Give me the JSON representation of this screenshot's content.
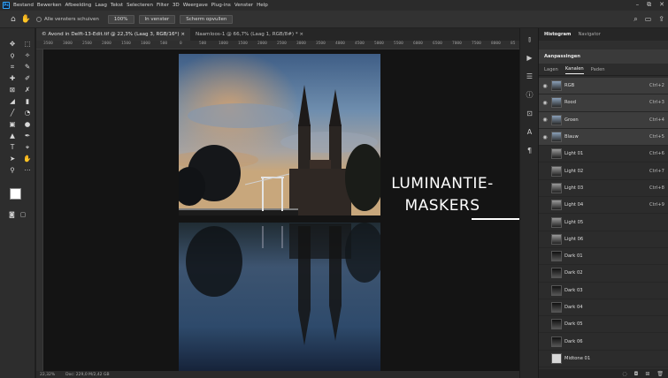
{
  "menu": [
    "Bestand",
    "Bewerken",
    "Afbeelding",
    "Laag",
    "Tekst",
    "Selecteren",
    "Filter",
    "3D",
    "Weergave",
    "Plug-ins",
    "Venster",
    "Help"
  ],
  "options": {
    "scroll_all_label": "Alle vensters schuiven",
    "zoom_value": "100%",
    "fit_label": "In venster",
    "fill_label": "Scherm opvullen"
  },
  "tabs": [
    {
      "label": "© Avond in Delft-13-Edit.tif @ 22,3% (Laag 3, RGB/16*) × "
    },
    {
      "label": "Naamloos-1 @ 66,7% (Laag 1, RGB/8#) * ×"
    }
  ],
  "ruler_ticks": [
    "3500",
    "3000",
    "2500",
    "2000",
    "1500",
    "1000",
    "500",
    "0",
    "500",
    "1000",
    "1500",
    "2000",
    "2500",
    "3000",
    "3500",
    "4000",
    "4500",
    "5000",
    "5500",
    "6000",
    "6500",
    "7000",
    "7500",
    "8000",
    "85"
  ],
  "status": {
    "zoom": "22,32%",
    "doc": "Doc: 229,0 M/2,42 GB"
  },
  "annotation": {
    "line1": "LUMINANTIE-",
    "line2": "MASKERS"
  },
  "panel_top_tabs": [
    "Histogram",
    "Navigator"
  ],
  "adjust_label": "Aanpassingen",
  "channel_tabs": [
    "Lagen",
    "Kanalen",
    "Paden"
  ],
  "channels": [
    {
      "name": "RGB",
      "shortcut": "Ctrl+2",
      "eye": true
    },
    {
      "name": "Rood",
      "shortcut": "Ctrl+3",
      "eye": true
    },
    {
      "name": "Groen",
      "shortcut": "Ctrl+4",
      "eye": true
    },
    {
      "name": "Blauw",
      "shortcut": "Ctrl+5",
      "eye": true
    },
    {
      "name": "Light 01",
      "shortcut": "Ctrl+6",
      "eye": false
    },
    {
      "name": "Light 02",
      "shortcut": "Ctrl+7",
      "eye": false
    },
    {
      "name": "Light 03",
      "shortcut": "Ctrl+8",
      "eye": false
    },
    {
      "name": "Light 04",
      "shortcut": "Ctrl+9",
      "eye": false
    },
    {
      "name": "Light 05",
      "shortcut": "",
      "eye": false
    },
    {
      "name": "Light 06",
      "shortcut": "",
      "eye": false
    },
    {
      "name": "Dark 01",
      "shortcut": "",
      "eye": false
    },
    {
      "name": "Dark 02",
      "shortcut": "",
      "eye": false
    },
    {
      "name": "Dark 03",
      "shortcut": "",
      "eye": false
    },
    {
      "name": "Dark 04",
      "shortcut": "",
      "eye": false
    },
    {
      "name": "Dark 05",
      "shortcut": "",
      "eye": false
    },
    {
      "name": "Dark 06",
      "shortcut": "",
      "eye": false
    },
    {
      "name": "Midtone 01",
      "shortcut": "",
      "eye": false
    }
  ],
  "colors": {
    "accent": "#31a8ff",
    "foreground": "#ffffff",
    "background": "#000000"
  }
}
